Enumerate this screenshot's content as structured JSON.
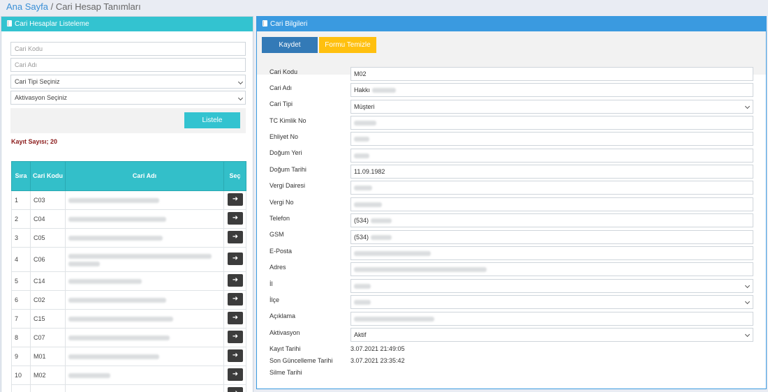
{
  "breadcrumb": {
    "home": "Ana Sayfa",
    "separator": " / ",
    "current": "Cari Hesap Tanımları"
  },
  "colors": {
    "cyan": "#33c3d0",
    "blue": "#3a9ae0",
    "save": "#337ab7",
    "clear": "#ffc00f",
    "count": "#8b1a1a"
  },
  "left": {
    "title": "Cari Hesaplar Listeleme",
    "filters": {
      "code_placeholder": "Cari Kodu",
      "name_placeholder": "Cari Adı",
      "type_select": "Cari Tipi Seçiniz",
      "activation_select": "Aktivasyon Seçiniz"
    },
    "list_button": "Listele",
    "record_count": "Kayıt Sayısı; 20",
    "table": {
      "headers": {
        "no": "Sıra",
        "code": "Cari Kodu",
        "name": "Cari Adı",
        "select": "Seç"
      },
      "rows": [
        {
          "no": "1",
          "code": "C03"
        },
        {
          "no": "2",
          "code": "C04"
        },
        {
          "no": "3",
          "code": "C05"
        },
        {
          "no": "4",
          "code": "C06"
        },
        {
          "no": "5",
          "code": "C14"
        },
        {
          "no": "6",
          "code": "C02"
        },
        {
          "no": "7",
          "code": "C15"
        },
        {
          "no": "8",
          "code": "C07"
        },
        {
          "no": "9",
          "code": "M01"
        },
        {
          "no": "10",
          "code": "M02"
        }
      ]
    }
  },
  "right": {
    "title": "Cari Bilgileri",
    "save_button": "Kaydet",
    "clear_button": "Formu Temizle",
    "fields": {
      "code_label": "Cari Kodu",
      "code_value": "M02",
      "name_label": "Cari Adı",
      "name_value": "Hakkı",
      "type_label": "Cari Tipi",
      "type_value": "Müşteri",
      "tc_label": "TC Kimlik No",
      "license_label": "Ehliyet No",
      "birthplace_label": "Doğum Yeri",
      "birthdate_label": "Doğum Tarihi",
      "birthdate_value": "11.09.1982",
      "taxoffice_label": "Vergi Dairesi",
      "taxno_label": "Vergi No",
      "phone_label": "Telefon",
      "phone_value": "(534)",
      "gsm_label": "GSM",
      "gsm_value": "(534)",
      "email_label": "E-Posta",
      "address_label": "Adres",
      "city_label": "İl",
      "district_label": "İlçe",
      "note_label": "Açıklama",
      "activation_label": "Aktivasyon",
      "activation_value": "Aktif",
      "created_label": "Kayıt Tarihi",
      "created_value": "3.07.2021 21:49:05",
      "updated_label": "Son Güncelleme Tarihi",
      "updated_value": "3.07.2021 23:35:42",
      "deleted_label": "Silme Tarihi"
    }
  }
}
